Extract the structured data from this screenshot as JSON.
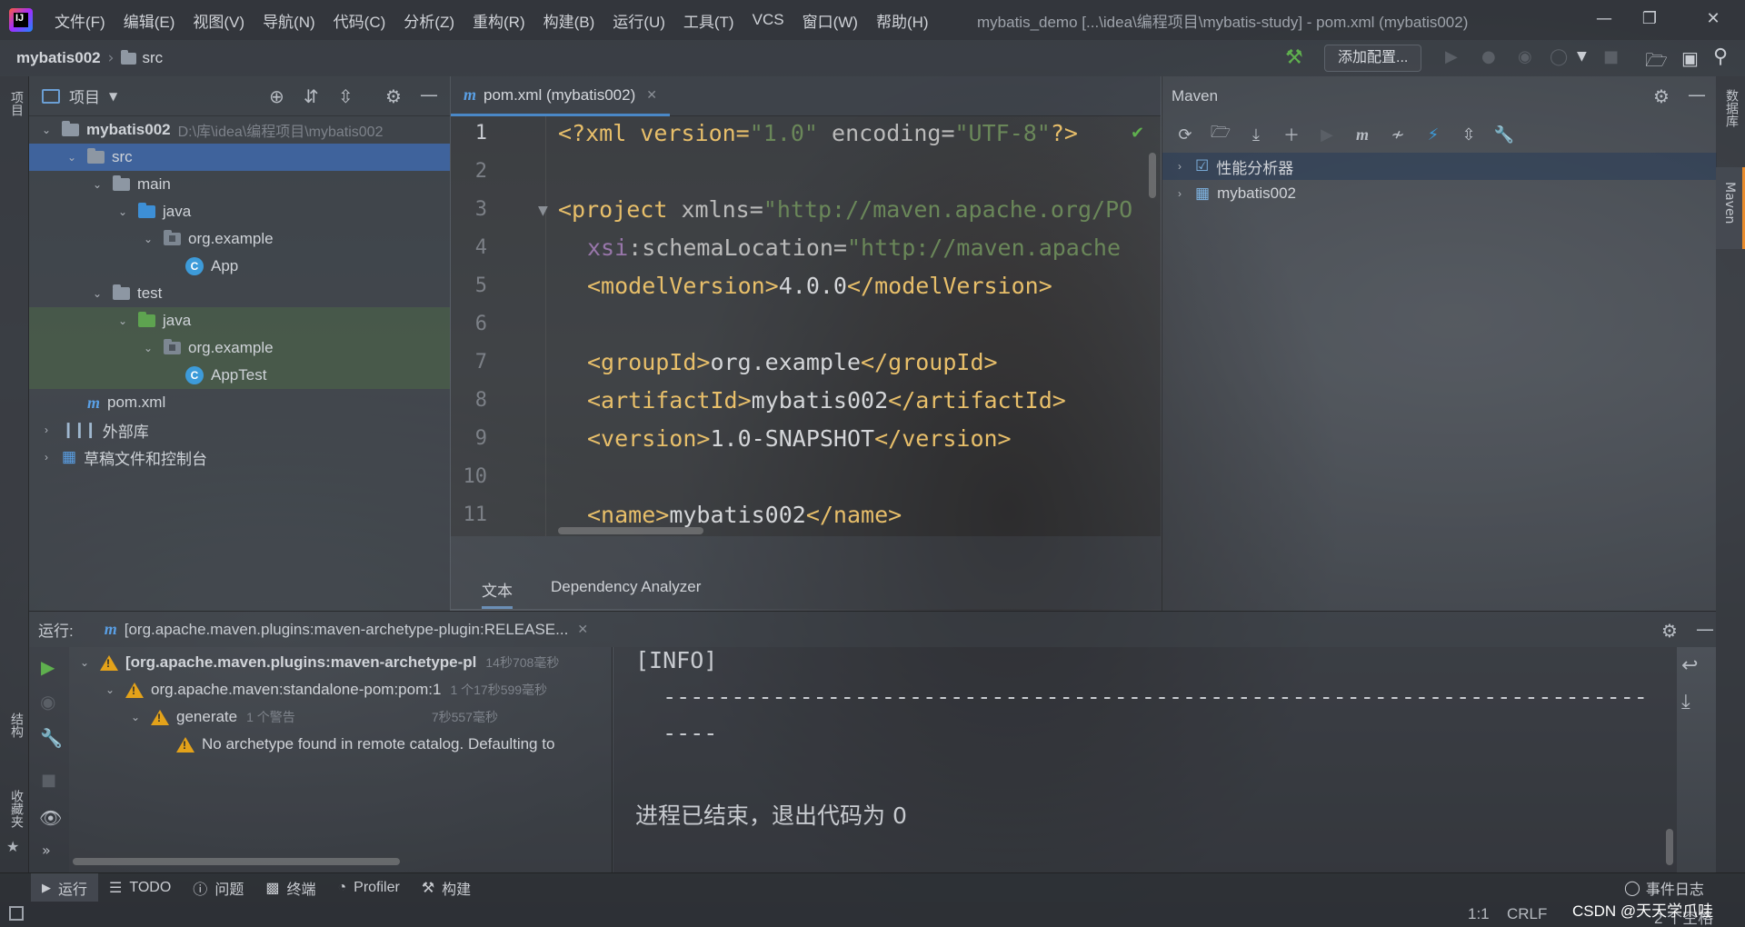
{
  "window": {
    "title": "mybatis_demo [...\\idea\\编程项目\\mybatis-study] - pom.xml (mybatis002)"
  },
  "menu": [
    "文件(F)",
    "编辑(E)",
    "视图(V)",
    "导航(N)",
    "代码(C)",
    "分析(Z)",
    "重构(R)",
    "构建(B)",
    "运行(U)",
    "工具(T)",
    "VCS",
    "窗口(W)",
    "帮助(H)"
  ],
  "breadcrumb": {
    "project": "mybatis002",
    "folder": "src"
  },
  "run_config": {
    "label": "添加配置..."
  },
  "left_strip": {
    "project_label": "项目",
    "structure_label": "结构",
    "favorites_label": "收藏夹"
  },
  "right_strip": {
    "database_label": "数据库",
    "maven_label": "Maven"
  },
  "project_panel": {
    "title": "项目",
    "tree": [
      {
        "label": "mybatis002",
        "path": "D:\\库\\idea\\编程项目\\mybatis002",
        "type": "module"
      },
      {
        "label": "src",
        "type": "folder"
      },
      {
        "label": "main",
        "type": "folder"
      },
      {
        "label": "java",
        "type": "source-folder"
      },
      {
        "label": "org.example",
        "type": "package"
      },
      {
        "label": "App",
        "type": "class"
      },
      {
        "label": "test",
        "type": "folder"
      },
      {
        "label": "java",
        "type": "test-folder"
      },
      {
        "label": "org.example",
        "type": "package"
      },
      {
        "label": "AppTest",
        "type": "class"
      },
      {
        "label": "pom.xml",
        "type": "maven-file"
      },
      {
        "label": "外部库",
        "type": "library"
      },
      {
        "label": "草稿文件和控制台",
        "type": "scratch"
      }
    ]
  },
  "editor": {
    "tab": "pom.xml (mybatis002)",
    "line_numbers": [
      "1",
      "2",
      "3",
      "4",
      "5",
      "6",
      "7",
      "8",
      "9",
      "10",
      "11"
    ],
    "lines": {
      "l1": {
        "a": "<?xml version=",
        "b": "\"1.0\"",
        "c": " encoding=",
        "d": "\"UTF-8\"",
        "e": "?>"
      },
      "l3": {
        "a": "<project ",
        "b": "xmlns=",
        "c": "\"http://maven.apache.org/PO"
      },
      "l4": {
        "a": "xsi",
        "b": ":schemaLocation=",
        "c": "\"http://maven.apache"
      },
      "l5": {
        "a": "<modelVersion>",
        "b": "4.0.0",
        "c": "</modelVersion>"
      },
      "l7": {
        "a": "<groupId>",
        "b": "org.example",
        "c": "</groupId>"
      },
      "l8": {
        "a": "<artifactId>",
        "b": "mybatis002",
        "c": "</artifactId>"
      },
      "l9": {
        "a": "<version>",
        "b": "1.0-SNAPSHOT",
        "c": "</version>"
      },
      "l11": {
        "a": "<name>",
        "b": "mybatis002",
        "c": "</name>"
      }
    },
    "bottom_tabs": [
      "文本",
      "Dependency Analyzer"
    ]
  },
  "maven": {
    "title": "Maven",
    "items": [
      "性能分析器",
      "mybatis002"
    ]
  },
  "run": {
    "label": "运行:",
    "tab": "[org.apache.maven.plugins:maven-archetype-plugin:RELEASE...",
    "tree": [
      {
        "label": "[org.apache.maven.plugins:maven-archetype-pl",
        "time": "14秒708毫秒"
      },
      {
        "label": "org.apache.maven:standalone-pom:pom:1",
        "meta": "1 个",
        "time": "17秒599毫秒"
      },
      {
        "label": "generate",
        "meta": "1 个警告",
        "time": "7秒557毫秒"
      },
      {
        "label": "No archetype found in remote catalog. Defaulting to"
      }
    ],
    "console": [
      "[INFO]",
      "  ------------------------------------------------------------------------",
      "  ----",
      "",
      "进程已结束，退出代码为 0"
    ]
  },
  "tool_tabs": [
    "运行",
    "TODO",
    "问题",
    "终端",
    "Profiler",
    "构建"
  ],
  "status": {
    "event_log": "事件日志",
    "position": "1:1",
    "line_sep": "CRLF",
    "spaces": "2 个空格",
    "watermark": "CSDN @天天学爪哇"
  }
}
